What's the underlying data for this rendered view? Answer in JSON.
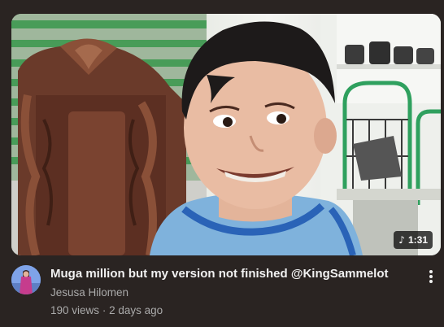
{
  "video": {
    "title": "Muga million but my version not finished @KingSammelot",
    "channel": "Jesusa Hilomen",
    "views": "190 views",
    "age": "2 days ago",
    "separator": "·",
    "duration": "1:31",
    "duration_icon": "music-note-icon"
  },
  "more_menu": {
    "icon": "more-vert-icon"
  },
  "colors": {
    "background": "#2a2422",
    "title": "#f1f1f1",
    "secondary": "#aaaaaa"
  }
}
